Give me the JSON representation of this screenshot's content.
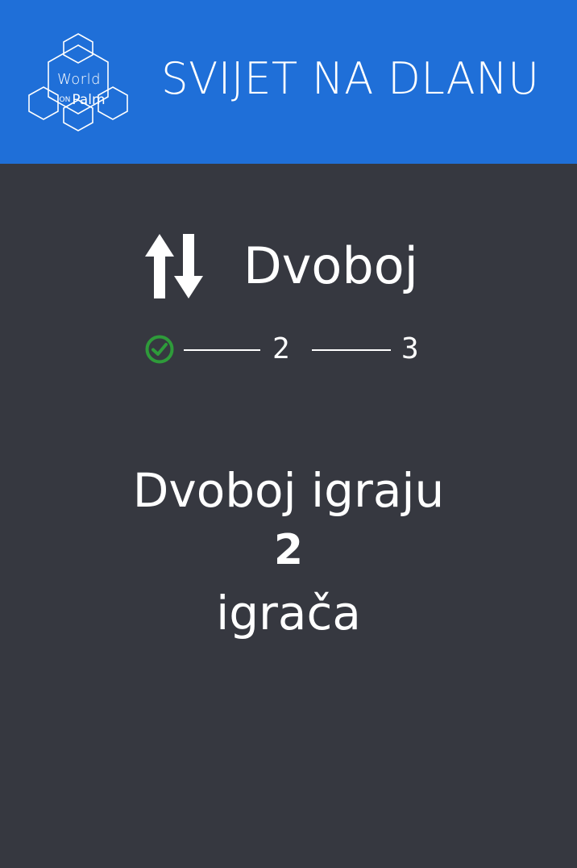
{
  "header": {
    "logo": {
      "word1": "World",
      "word2_small": "ON",
      "word2": "Palm"
    },
    "title": "SVIJET NA DLANU",
    "background_color": "#1f6fd8"
  },
  "mode": {
    "icon": "up-down-arrows-icon",
    "title": "Dvoboj"
  },
  "steps": {
    "current": 1,
    "items": [
      {
        "icon": "check-circle-icon",
        "completed": true,
        "color": "#2e9b3a"
      },
      {
        "label": "2",
        "completed": false
      },
      {
        "label": "3",
        "completed": false
      }
    ]
  },
  "info": {
    "line1": "Dvoboj igraju",
    "player_count": "2",
    "line3": "igrača"
  },
  "colors": {
    "background": "#363840",
    "text": "#ffffff"
  }
}
